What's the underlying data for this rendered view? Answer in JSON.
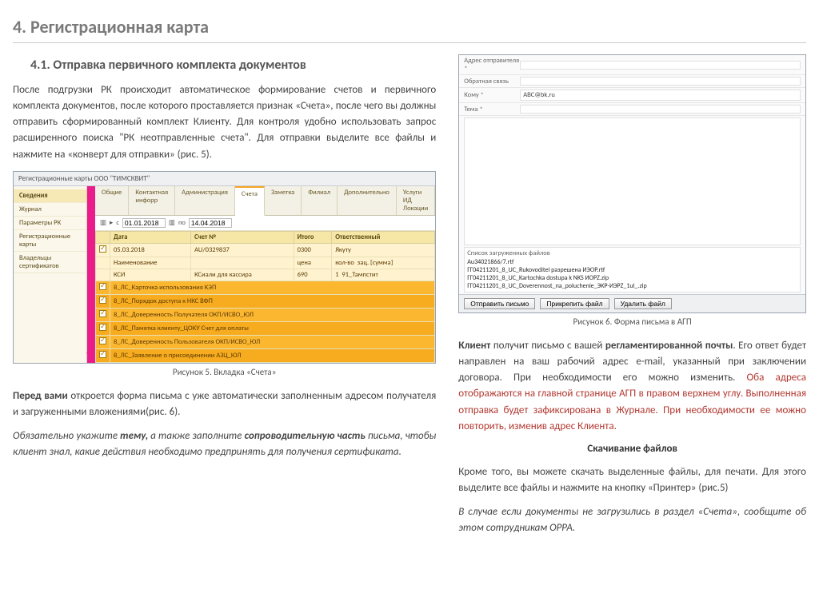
{
  "heading_main": "4. Регистрационная карта",
  "heading_sub": "4.1. Отправка первичного комплекта документов",
  "left": {
    "p1": "После подгрузки РК происходит автоматическое формирование счетов и первичного комплекта документов, после которого проставляется признак «Счета», после чего вы должны отправить сформированный комплект Клиенту. Для контроля удобно использовать запрос расширенного поиска \"РК неотправленные счета\". Для отправки выделите все файлы и нажмите на «конверт для отправки» (рис. 5).",
    "caption5": "Рисунок 5. Вкладка «Счета»",
    "p2a": "Перед вами",
    "p2b": " откроется форма письма с уже автоматически заполненным адресом получателя и загруженными вложениями(рис. 6).",
    "p3a": "Обязательно укажите ",
    "p3b": "тему,",
    "p3c": " а также заполните ",
    "p3d": "сопроводительную часть",
    "p3e": " письма, чтобы клиент знал, какие действия необходимо предпринять для получения сертификата."
  },
  "right": {
    "caption6": "Рисунок 6. Форма письма в АГП",
    "p1a": "Клиент",
    "p1b": " получит письмо с вашей ",
    "p1c": "регламентированной почты",
    "p1d": ".  Его ответ будет направлен на ваш рабочий адрес e-mail, указанный при заключении договора. При необходимости его можно изменить. ",
    "p1e": "Оба адреса отображаются на главной странице АГП в правом верхнем углу. Выполненная отправка будет зафиксирована в Журнале. При необходимости ее можно повторить, изменив адрес Клиента.",
    "h_download": "Скачивание файлов",
    "p2": "Кроме того, вы можете скачать выделенные файлы, для печати. Для этого выделите все файлы и нажмите на кнопку «Принтер» (рис.5)",
    "p3": "В случае если документы не загрузились в раздел «Счета», сообщите об этом сотрудникам ОРРА."
  },
  "fig5": {
    "title": "Регистрационные карты ООО \"ТИМCКВИТ\"",
    "nav": [
      "Сведения",
      "Журнал",
      "Параметры РК",
      "Регистрационные карты",
      "Владельцы сертификатов"
    ],
    "tabs": [
      "Общие",
      "Контактная инфорр",
      "Администрация",
      "Счета",
      "Заметка",
      "Филиал",
      "Дополнительно",
      "Услуги ИД Локации"
    ],
    "active_tab_index": 3,
    "date_label_from": "с",
    "date_from": "01.01.2018",
    "date_label_to": "по",
    "date_to": "14.04.2018",
    "columns": [
      "",
      "Дата",
      "Счет №",
      "Итого",
      "Ответственный"
    ],
    "row1": [
      "05.03.2018",
      "AU/0329837",
      "0300",
      "Якуту"
    ],
    "sub_columns": [
      "",
      "Наименование",
      "",
      "цена",
      "кол-во",
      "зац. [сумма]"
    ],
    "sub1": [
      "КСИ",
      "КСиали для кассира",
      "",
      "690",
      "1",
      "91_Тампстит"
    ],
    "files": [
      "8_ЛС_Карточка использования КЭП",
      "8_ЛС_Порядок доступа к НКС ВФП",
      "8_ЛС_Доверенность Получателя ОКП/ИСВО_ЮЛ",
      "8_ЛС_Памятка клиенту_ЦОКУ Счет для оплаты",
      "8_ЛС_Доверенность Пользователя ОКП/ИСВО_ЮЛ",
      "8_ЛС_Заявление о присоединении АЗЦ_ЮЛ"
    ]
  },
  "fig6": {
    "lbl_from": "Адрес отправителя *",
    "lbl_cc": "Обратная связь",
    "lbl_to": "Кому *",
    "lbl_subj": "Тема *",
    "val_to": "ABC@bk.ru",
    "attach_label": "Список загруженных файлов",
    "attachments": [
      "Au34021866/7.rtf",
      "ГГ04211201_8_UC_Rukovoditel разрешена ИЭОР.rtf",
      "ГГ04211201_8_UC_Kartochka dostupa k NKS ИОРZ.zip",
      "ГГ04211201_8_UC_Doverennost_na_poluchenie_ЭКР-ИЭРZ_1ul_.zip"
    ],
    "btn_send": "Отправить письмо",
    "btn_add": "Прикрепить файл",
    "btn_del": "Удалить файл"
  }
}
